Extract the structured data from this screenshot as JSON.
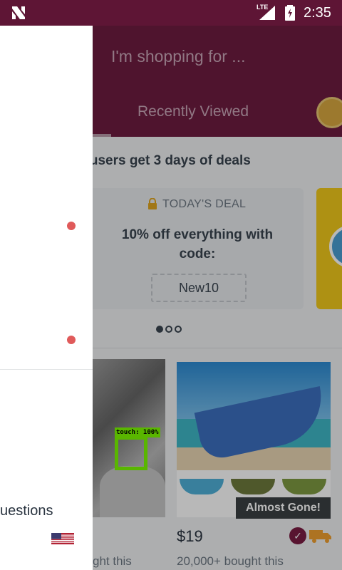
{
  "status_bar": {
    "network": "LTE",
    "time": "2:35"
  },
  "header": {
    "search_placeholder": "I'm shopping for ...",
    "tab_label": "Recently Viewed"
  },
  "promo": {
    "text": "y users get 3 days of deals"
  },
  "deal": {
    "label": "TODAY'S DEAL",
    "title": "10% off everything with code:",
    "code": "New10",
    "pager": {
      "count": 3,
      "active_index": 0
    }
  },
  "products": [
    {
      "price": "",
      "bought": "ght this"
    },
    {
      "price": "$19",
      "bought": "20,000+ bought this",
      "badge": "Almost Gone!"
    }
  ],
  "overlay": {
    "touch_label": "touch: 100%"
  },
  "drawer": {
    "item_label": "uestions",
    "country": "US"
  },
  "colors": {
    "brand": "#6e1c40",
    "status_bar": "#5e1535",
    "notification_dot": "#e05a5a",
    "touch_overlay": "#7cfc00"
  }
}
